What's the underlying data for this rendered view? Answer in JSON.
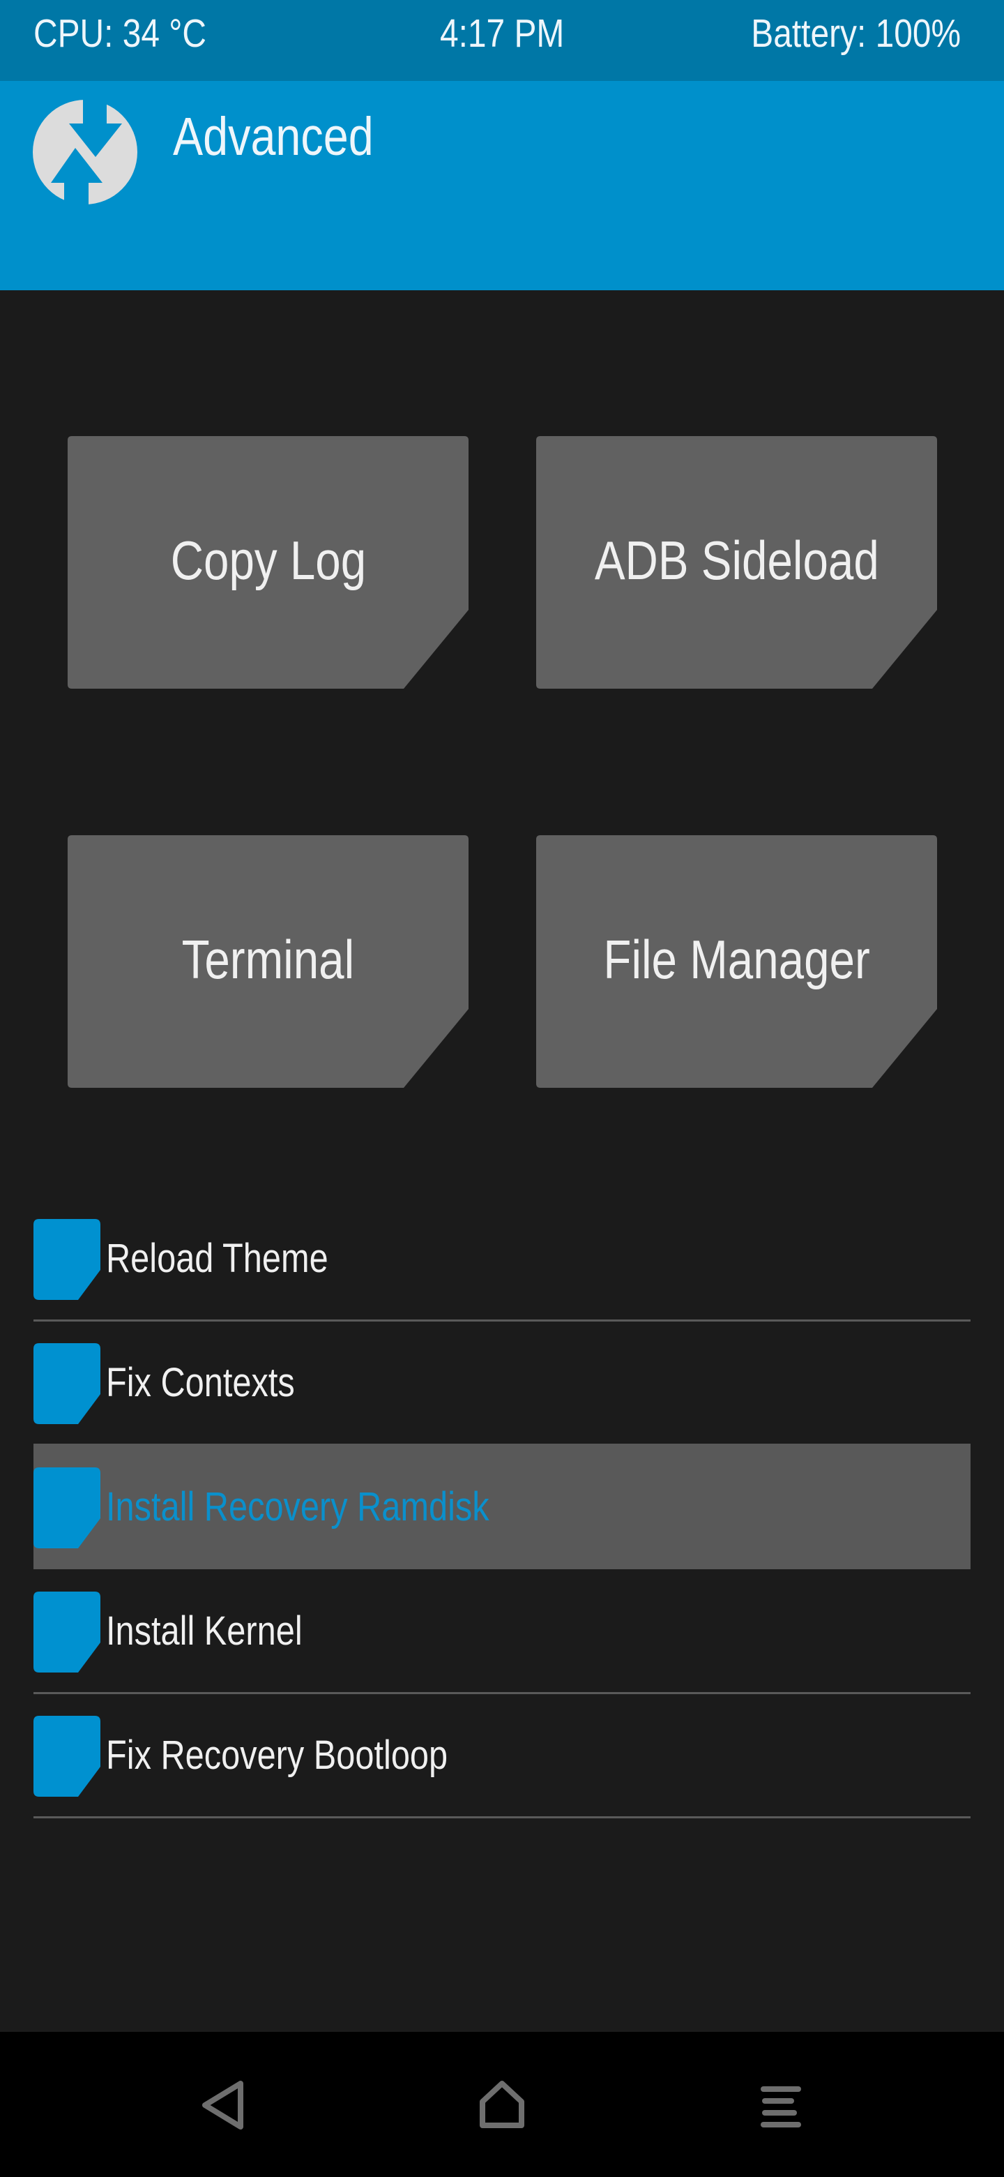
{
  "status_bar": {
    "cpu": "CPU: 34 °C",
    "time": "4:17 PM",
    "battery": "Battery: 100%"
  },
  "header": {
    "logo_icon": "twrp-logo-icon",
    "title": "Advanced"
  },
  "actions": [
    {
      "label": "Copy Log"
    },
    {
      "label": "ADB Sideload"
    },
    {
      "label": "Terminal"
    },
    {
      "label": "File Manager"
    }
  ],
  "options": [
    {
      "label": "Reload Theme",
      "checked": false,
      "selected": false
    },
    {
      "label": "Fix Contexts",
      "checked": false,
      "selected": false
    },
    {
      "label": "Install Recovery Ramdisk",
      "checked": false,
      "selected": true
    },
    {
      "label": "Install Kernel",
      "checked": false,
      "selected": false
    },
    {
      "label": "Fix Recovery Bootloop",
      "checked": false,
      "selected": false
    }
  ],
  "nav_bar": {
    "back_icon": "back-icon",
    "home_icon": "home-icon",
    "menu_icon": "menu-icon"
  },
  "colors": {
    "status_bar": "#0077a6",
    "accent": "#0090cb",
    "background": "#1b1b1b",
    "button": "#616161",
    "selected_row": "#595959",
    "text": "#f0f0f0"
  }
}
